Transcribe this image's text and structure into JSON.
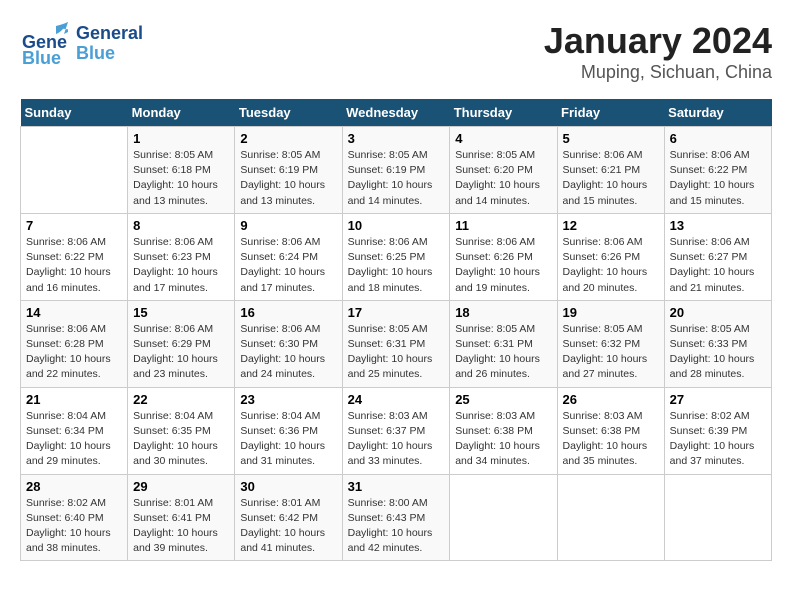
{
  "logo": {
    "line1": "General",
    "line2": "Blue"
  },
  "title": "January 2024",
  "subtitle": "Muping, Sichuan, China",
  "days_of_week": [
    "Sunday",
    "Monday",
    "Tuesday",
    "Wednesday",
    "Thursday",
    "Friday",
    "Saturday"
  ],
  "weeks": [
    [
      {
        "day": null,
        "info": null
      },
      {
        "day": "1",
        "info": "Sunrise: 8:05 AM\nSunset: 6:18 PM\nDaylight: 10 hours\nand 13 minutes."
      },
      {
        "day": "2",
        "info": "Sunrise: 8:05 AM\nSunset: 6:19 PM\nDaylight: 10 hours\nand 13 minutes."
      },
      {
        "day": "3",
        "info": "Sunrise: 8:05 AM\nSunset: 6:19 PM\nDaylight: 10 hours\nand 14 minutes."
      },
      {
        "day": "4",
        "info": "Sunrise: 8:05 AM\nSunset: 6:20 PM\nDaylight: 10 hours\nand 14 minutes."
      },
      {
        "day": "5",
        "info": "Sunrise: 8:06 AM\nSunset: 6:21 PM\nDaylight: 10 hours\nand 15 minutes."
      },
      {
        "day": "6",
        "info": "Sunrise: 8:06 AM\nSunset: 6:22 PM\nDaylight: 10 hours\nand 15 minutes."
      }
    ],
    [
      {
        "day": "7",
        "info": "Sunrise: 8:06 AM\nSunset: 6:22 PM\nDaylight: 10 hours\nand 16 minutes."
      },
      {
        "day": "8",
        "info": "Sunrise: 8:06 AM\nSunset: 6:23 PM\nDaylight: 10 hours\nand 17 minutes."
      },
      {
        "day": "9",
        "info": "Sunrise: 8:06 AM\nSunset: 6:24 PM\nDaylight: 10 hours\nand 17 minutes."
      },
      {
        "day": "10",
        "info": "Sunrise: 8:06 AM\nSunset: 6:25 PM\nDaylight: 10 hours\nand 18 minutes."
      },
      {
        "day": "11",
        "info": "Sunrise: 8:06 AM\nSunset: 6:26 PM\nDaylight: 10 hours\nand 19 minutes."
      },
      {
        "day": "12",
        "info": "Sunrise: 8:06 AM\nSunset: 6:26 PM\nDaylight: 10 hours\nand 20 minutes."
      },
      {
        "day": "13",
        "info": "Sunrise: 8:06 AM\nSunset: 6:27 PM\nDaylight: 10 hours\nand 21 minutes."
      }
    ],
    [
      {
        "day": "14",
        "info": "Sunrise: 8:06 AM\nSunset: 6:28 PM\nDaylight: 10 hours\nand 22 minutes."
      },
      {
        "day": "15",
        "info": "Sunrise: 8:06 AM\nSunset: 6:29 PM\nDaylight: 10 hours\nand 23 minutes."
      },
      {
        "day": "16",
        "info": "Sunrise: 8:06 AM\nSunset: 6:30 PM\nDaylight: 10 hours\nand 24 minutes."
      },
      {
        "day": "17",
        "info": "Sunrise: 8:05 AM\nSunset: 6:31 PM\nDaylight: 10 hours\nand 25 minutes."
      },
      {
        "day": "18",
        "info": "Sunrise: 8:05 AM\nSunset: 6:31 PM\nDaylight: 10 hours\nand 26 minutes."
      },
      {
        "day": "19",
        "info": "Sunrise: 8:05 AM\nSunset: 6:32 PM\nDaylight: 10 hours\nand 27 minutes."
      },
      {
        "day": "20",
        "info": "Sunrise: 8:05 AM\nSunset: 6:33 PM\nDaylight: 10 hours\nand 28 minutes."
      }
    ],
    [
      {
        "day": "21",
        "info": "Sunrise: 8:04 AM\nSunset: 6:34 PM\nDaylight: 10 hours\nand 29 minutes."
      },
      {
        "day": "22",
        "info": "Sunrise: 8:04 AM\nSunset: 6:35 PM\nDaylight: 10 hours\nand 30 minutes."
      },
      {
        "day": "23",
        "info": "Sunrise: 8:04 AM\nSunset: 6:36 PM\nDaylight: 10 hours\nand 31 minutes."
      },
      {
        "day": "24",
        "info": "Sunrise: 8:03 AM\nSunset: 6:37 PM\nDaylight: 10 hours\nand 33 minutes."
      },
      {
        "day": "25",
        "info": "Sunrise: 8:03 AM\nSunset: 6:38 PM\nDaylight: 10 hours\nand 34 minutes."
      },
      {
        "day": "26",
        "info": "Sunrise: 8:03 AM\nSunset: 6:38 PM\nDaylight: 10 hours\nand 35 minutes."
      },
      {
        "day": "27",
        "info": "Sunrise: 8:02 AM\nSunset: 6:39 PM\nDaylight: 10 hours\nand 37 minutes."
      }
    ],
    [
      {
        "day": "28",
        "info": "Sunrise: 8:02 AM\nSunset: 6:40 PM\nDaylight: 10 hours\nand 38 minutes."
      },
      {
        "day": "29",
        "info": "Sunrise: 8:01 AM\nSunset: 6:41 PM\nDaylight: 10 hours\nand 39 minutes."
      },
      {
        "day": "30",
        "info": "Sunrise: 8:01 AM\nSunset: 6:42 PM\nDaylight: 10 hours\nand 41 minutes."
      },
      {
        "day": "31",
        "info": "Sunrise: 8:00 AM\nSunset: 6:43 PM\nDaylight: 10 hours\nand 42 minutes."
      },
      {
        "day": null,
        "info": null
      },
      {
        "day": null,
        "info": null
      },
      {
        "day": null,
        "info": null
      }
    ]
  ]
}
